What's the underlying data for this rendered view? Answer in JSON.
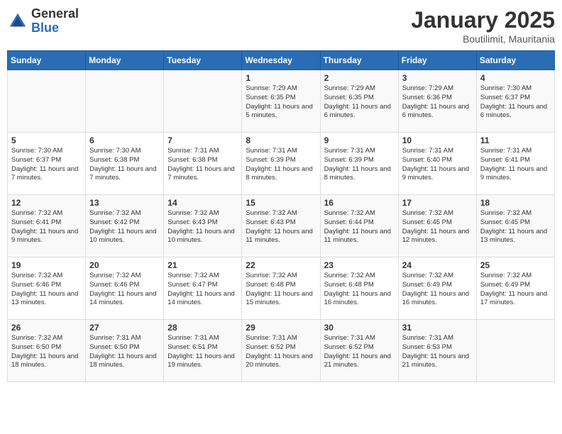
{
  "header": {
    "logo_general": "General",
    "logo_blue": "Blue",
    "month_title": "January 2025",
    "location": "Boutilimit, Mauritania"
  },
  "weekdays": [
    "Sunday",
    "Monday",
    "Tuesday",
    "Wednesday",
    "Thursday",
    "Friday",
    "Saturday"
  ],
  "weeks": [
    [
      {
        "day": "",
        "info": ""
      },
      {
        "day": "",
        "info": ""
      },
      {
        "day": "",
        "info": ""
      },
      {
        "day": "1",
        "info": "Sunrise: 7:29 AM\nSunset: 6:35 PM\nDaylight: 11 hours and 5 minutes."
      },
      {
        "day": "2",
        "info": "Sunrise: 7:29 AM\nSunset: 6:35 PM\nDaylight: 11 hours and 6 minutes."
      },
      {
        "day": "3",
        "info": "Sunrise: 7:29 AM\nSunset: 6:36 PM\nDaylight: 11 hours and 6 minutes."
      },
      {
        "day": "4",
        "info": "Sunrise: 7:30 AM\nSunset: 6:37 PM\nDaylight: 11 hours and 6 minutes."
      }
    ],
    [
      {
        "day": "5",
        "info": "Sunrise: 7:30 AM\nSunset: 6:37 PM\nDaylight: 11 hours and 7 minutes."
      },
      {
        "day": "6",
        "info": "Sunrise: 7:30 AM\nSunset: 6:38 PM\nDaylight: 11 hours and 7 minutes."
      },
      {
        "day": "7",
        "info": "Sunrise: 7:31 AM\nSunset: 6:38 PM\nDaylight: 11 hours and 7 minutes."
      },
      {
        "day": "8",
        "info": "Sunrise: 7:31 AM\nSunset: 6:39 PM\nDaylight: 11 hours and 8 minutes."
      },
      {
        "day": "9",
        "info": "Sunrise: 7:31 AM\nSunset: 6:39 PM\nDaylight: 11 hours and 8 minutes."
      },
      {
        "day": "10",
        "info": "Sunrise: 7:31 AM\nSunset: 6:40 PM\nDaylight: 11 hours and 9 minutes."
      },
      {
        "day": "11",
        "info": "Sunrise: 7:31 AM\nSunset: 6:41 PM\nDaylight: 11 hours and 9 minutes."
      }
    ],
    [
      {
        "day": "12",
        "info": "Sunrise: 7:32 AM\nSunset: 6:41 PM\nDaylight: 11 hours and 9 minutes."
      },
      {
        "day": "13",
        "info": "Sunrise: 7:32 AM\nSunset: 6:42 PM\nDaylight: 11 hours and 10 minutes."
      },
      {
        "day": "14",
        "info": "Sunrise: 7:32 AM\nSunset: 6:43 PM\nDaylight: 11 hours and 10 minutes."
      },
      {
        "day": "15",
        "info": "Sunrise: 7:32 AM\nSunset: 6:43 PM\nDaylight: 11 hours and 11 minutes."
      },
      {
        "day": "16",
        "info": "Sunrise: 7:32 AM\nSunset: 6:44 PM\nDaylight: 11 hours and 11 minutes."
      },
      {
        "day": "17",
        "info": "Sunrise: 7:32 AM\nSunset: 6:45 PM\nDaylight: 11 hours and 12 minutes."
      },
      {
        "day": "18",
        "info": "Sunrise: 7:32 AM\nSunset: 6:45 PM\nDaylight: 11 hours and 13 minutes."
      }
    ],
    [
      {
        "day": "19",
        "info": "Sunrise: 7:32 AM\nSunset: 6:46 PM\nDaylight: 11 hours and 13 minutes."
      },
      {
        "day": "20",
        "info": "Sunrise: 7:32 AM\nSunset: 6:46 PM\nDaylight: 11 hours and 14 minutes."
      },
      {
        "day": "21",
        "info": "Sunrise: 7:32 AM\nSunset: 6:47 PM\nDaylight: 11 hours and 14 minutes."
      },
      {
        "day": "22",
        "info": "Sunrise: 7:32 AM\nSunset: 6:48 PM\nDaylight: 11 hours and 15 minutes."
      },
      {
        "day": "23",
        "info": "Sunrise: 7:32 AM\nSunset: 6:48 PM\nDaylight: 11 hours and 16 minutes."
      },
      {
        "day": "24",
        "info": "Sunrise: 7:32 AM\nSunset: 6:49 PM\nDaylight: 11 hours and 16 minutes."
      },
      {
        "day": "25",
        "info": "Sunrise: 7:32 AM\nSunset: 6:49 PM\nDaylight: 11 hours and 17 minutes."
      }
    ],
    [
      {
        "day": "26",
        "info": "Sunrise: 7:32 AM\nSunset: 6:50 PM\nDaylight: 11 hours and 18 minutes."
      },
      {
        "day": "27",
        "info": "Sunrise: 7:31 AM\nSunset: 6:50 PM\nDaylight: 11 hours and 18 minutes."
      },
      {
        "day": "28",
        "info": "Sunrise: 7:31 AM\nSunset: 6:51 PM\nDaylight: 11 hours and 19 minutes."
      },
      {
        "day": "29",
        "info": "Sunrise: 7:31 AM\nSunset: 6:52 PM\nDaylight: 11 hours and 20 minutes."
      },
      {
        "day": "30",
        "info": "Sunrise: 7:31 AM\nSunset: 6:52 PM\nDaylight: 11 hours and 21 minutes."
      },
      {
        "day": "31",
        "info": "Sunrise: 7:31 AM\nSunset: 6:53 PM\nDaylight: 11 hours and 21 minutes."
      },
      {
        "day": "",
        "info": ""
      }
    ]
  ]
}
